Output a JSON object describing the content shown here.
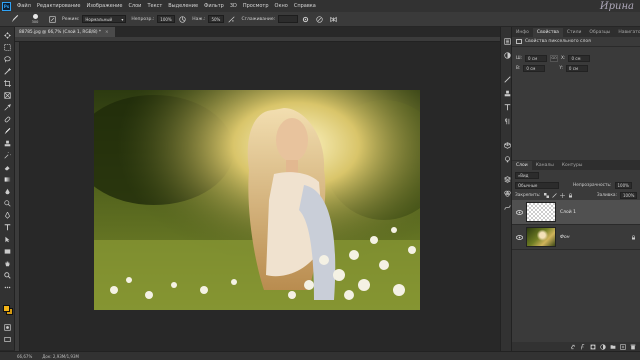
{
  "app": {
    "logo": "Ps",
    "watermark": "Ирина"
  },
  "menu": [
    "Файл",
    "Редактирование",
    "Изображение",
    "Слои",
    "Текст",
    "Выделение",
    "Фильтр",
    "3D",
    "Просмотр",
    "Окно",
    "Справка"
  ],
  "options": {
    "brush_size": "300",
    "mode_label": "Режим:",
    "mode_value": "Нормальный",
    "opacity_label": "Непрозр.:",
    "opacity_value": "100%",
    "flow_label": "Наж.:",
    "flow_value": "50%",
    "smoothing_label": "Сглаживание:"
  },
  "document": {
    "tab_title": "88785.jpg @ 66,7% (Слой 1, RGB/8) *",
    "close": "×"
  },
  "status": {
    "zoom": "66,67%",
    "doc_info": "Док: 2,93М/1,93М"
  },
  "properties": {
    "tabs": [
      "Инфо",
      "Свойства",
      "Стили",
      "Образцы",
      "Навигатор"
    ],
    "active_tab": 1,
    "header": "Свойства пиксельного слоя",
    "w_label": "Ш:",
    "w_value": "0 см",
    "link": "GO",
    "x_label": "X:",
    "x_value": "0 см",
    "h_label": "В:",
    "h_value": "0 см",
    "y_label": "Y:",
    "y_value": "0 см"
  },
  "layers": {
    "tabs": [
      "Слои",
      "Каналы",
      "Контуры"
    ],
    "active_tab": 0,
    "filter_kind": "Вид",
    "blend_mode": "Обычные",
    "opacity_label": "Непрозрачность:",
    "opacity_value": "100%",
    "lock_label": "Закрепить:",
    "fill_label": "Заливка:",
    "fill_value": "100%",
    "items": [
      {
        "name": "Слой 1",
        "selected": true,
        "thumb": "transparent"
      },
      {
        "name": "Фон",
        "selected": false,
        "thumb": "photo",
        "locked": true
      }
    ]
  },
  "colors": {
    "foreground": "#f3b417",
    "background": "#d49a12",
    "accent": "#2fa3f7",
    "panel": "#3a3a3a",
    "workspace": "#282828"
  }
}
